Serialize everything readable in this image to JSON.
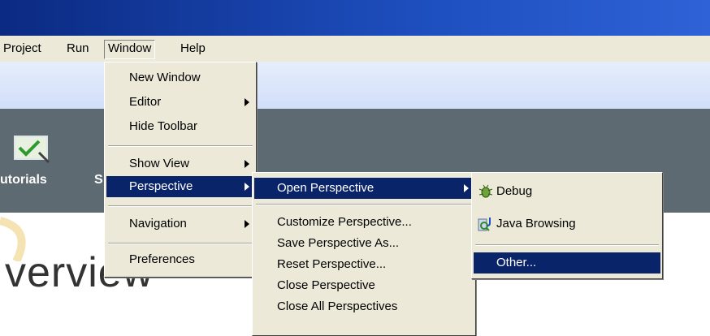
{
  "menubar": {
    "items": [
      {
        "label": "Project",
        "accel": ""
      },
      {
        "label": "Run",
        "accel": "R"
      },
      {
        "label": "Window",
        "accel": "W"
      },
      {
        "label": "Help",
        "accel": "H"
      }
    ]
  },
  "welcome": {
    "tutorials_label": "utorials",
    "samples_label": "S",
    "overview_title": "verview"
  },
  "window_menu": {
    "items": [
      {
        "label": "New Window"
      },
      {
        "label": "Editor"
      },
      {
        "label": "Hide Toolbar"
      },
      {
        "label": "Show View"
      },
      {
        "label": "Perspective"
      },
      {
        "label": "Navigation"
      },
      {
        "label": "Preferences"
      }
    ]
  },
  "perspective_menu": {
    "items": [
      {
        "label": "Open Perspective"
      },
      {
        "label": "Customize Perspective..."
      },
      {
        "label": "Save Perspective As..."
      },
      {
        "label": "Reset Perspective..."
      },
      {
        "label": "Close Perspective"
      },
      {
        "label": "Close All Perspectives"
      }
    ]
  },
  "open_perspective_menu": {
    "items": [
      {
        "label": "Debug",
        "icon": "debug-bug-icon"
      },
      {
        "label": "Java Browsing",
        "icon": "java-browsing-icon"
      },
      {
        "label": "Other..."
      }
    ]
  },
  "colors": {
    "menu_highlight": "#0a246a",
    "menu_background": "#ece9d8",
    "welcome_band": "#5e6a72"
  }
}
